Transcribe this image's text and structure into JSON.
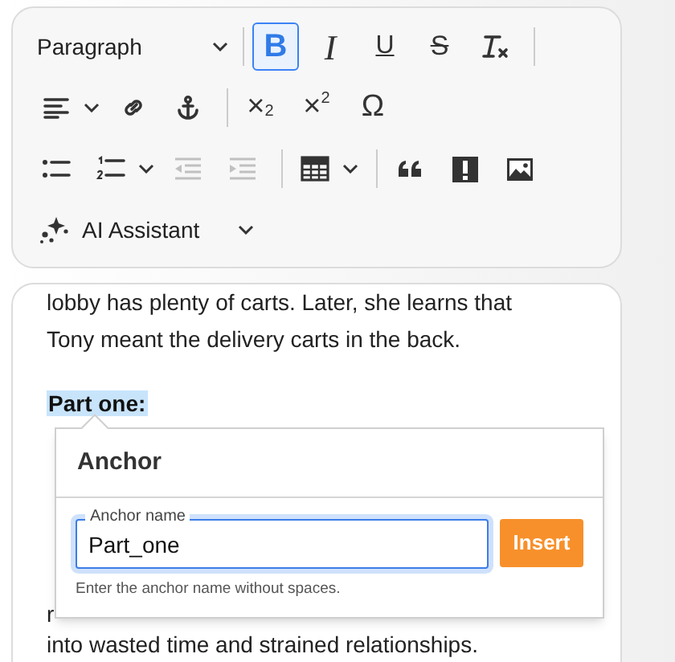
{
  "toolbar": {
    "rows": [
      [
        {
          "kind": "select",
          "label": "Paragraph"
        },
        {
          "kind": "separator"
        },
        {
          "kind": "toggle",
          "label": "B",
          "selected": true
        },
        {
          "kind": "toggle",
          "label": "I",
          "selected": false
        },
        {
          "kind": "toggle",
          "label": "U",
          "selected": false
        },
        {
          "kind": "toggle",
          "label": "S",
          "selected": false
        },
        {
          "kind": "icon",
          "disabled": false
        },
        {
          "kind": "separator"
        }
      ],
      [
        {
          "kind": "icon",
          "disabled": false
        },
        {
          "kind": "caret"
        },
        {
          "kind": "icon",
          "disabled": false
        },
        {
          "kind": "icon",
          "disabled": false
        },
        {
          "kind": "separator"
        },
        {
          "kind": "char",
          "label": "×$_{2}$"
        },
        {
          "kind": "char",
          "label": "×$^{2}$"
        },
        {
          "kind": "char",
          "label": "Ω"
        }
      ],
      [
        {
          "kind": "icon",
          "disabled": false
        },
        {
          "kind": "icon",
          "disabled": false
        },
        {
          "kind": "caret"
        },
        {
          "kind": "icon",
          "disabled": true
        },
        {
          "kind": "icon",
          "disabled": true
        },
        {
          "kind": "separator"
        },
        {
          "kind": "icon",
          "disabled": false
        },
        {
          "kind": "caret"
        },
        {
          "kind": "separator"
        },
        {
          "kind": "icon",
          "disabled": false
        },
        {
          "kind": "icon",
          "disabled": false
        },
        {
          "kind": "icon",
          "disabled": false
        }
      ],
      [
        {
          "kind": "assistant",
          "label": "AI Assistant"
        }
      ]
    ]
  },
  "editor": {
    "blocks": [
      {
        "kind": "text",
        "lines": [
          [
            "lobby has plenty of carts. Later, she learns that"
          ],
          [
            "Tony meant the delivery carts in the back."
          ]
        ]
      },
      {
        "kind": "heading",
        "text": "Part one:",
        "highlighted": true
      },
      {
        "kind": "covered_text",
        "lines": [
          [
            "r"
          ],
          [
            "into wasted time and strained relationships."
          ]
        ]
      }
    ]
  },
  "anchor_popup": {
    "title": "Anchor",
    "field": {
      "label": "Anchor name",
      "value": "Part_one",
      "focused": true
    },
    "hint": "Enter the anchor name without spaces.",
    "button": "Insert"
  }
}
